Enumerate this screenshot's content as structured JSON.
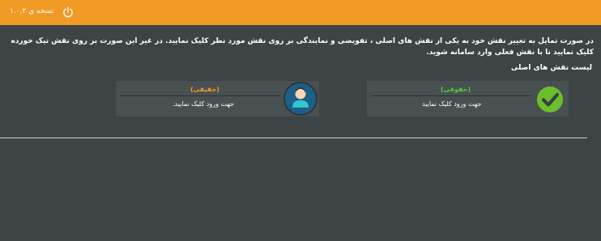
{
  "header": {
    "version_label": "نسخه ی ۱.۰.۲",
    "power_icon": "power-icon",
    "background": "#f19a26"
  },
  "intro_text": "در صورت تمایل به تغییر نقش خود به یکی از نقش های اصلی ، تفویضی و نمایندگی بر روی نقش مورد نظر کلیک نمایید. در غیر این صورت بر روی نقش تیک خورده کلیک نمایید تا با نقش فعلی وارد سامانه شوید.",
  "section_title": "لیست نقش های اصلی",
  "roles": [
    {
      "role_label": "(حقوقی)",
      "hint": "جهت ورود کلیک نمایید",
      "icon": "check-icon",
      "role_color": "#4cd137",
      "selected": true
    },
    {
      "role_label": "(حقیقی)",
      "hint": "جهت ورود کلیک نمایید.",
      "icon": "user-avatar-icon",
      "role_color": "#f19a26",
      "selected": false
    }
  ]
}
